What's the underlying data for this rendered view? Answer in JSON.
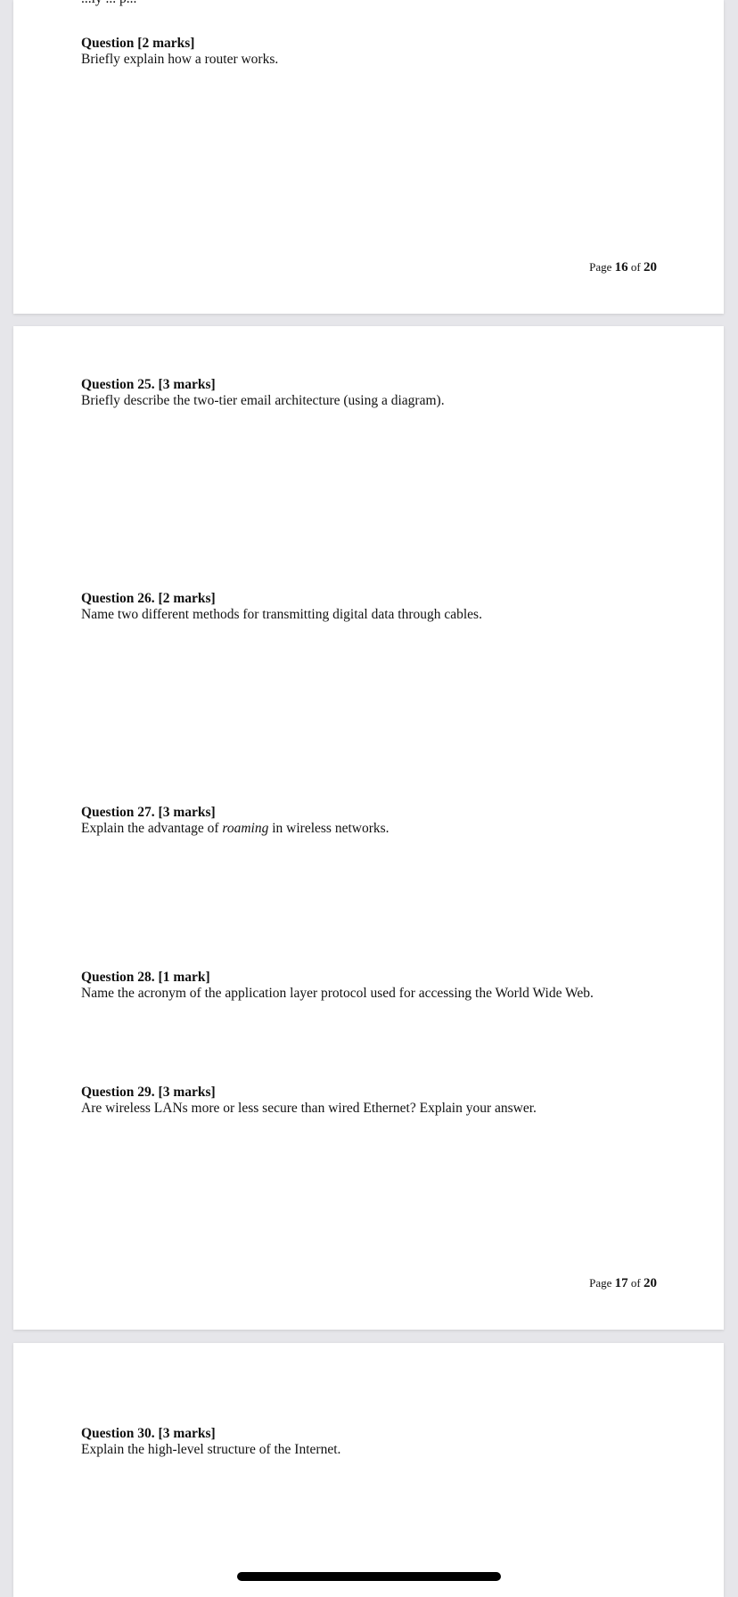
{
  "pages": [
    {
      "top_fragment": "...ly ... p...",
      "questions": [
        {
          "title": "Question  [2 marks]",
          "text": "Briefly explain how a router works."
        }
      ],
      "footer": {
        "prefix": "Page",
        "current": "16",
        "of": "of",
        "total": "20"
      }
    },
    {
      "questions": [
        {
          "title": "Question 25. [3 marks]",
          "text": "Briefly describe the two-tier email architecture (using a diagram)."
        },
        {
          "title": "Question 26. [2 marks]",
          "text": "Name two different methods for transmitting digital data through cables."
        },
        {
          "title": "Question 27. [3 marks]",
          "text_before": "Explain the advantage of",
          "text_em": "roaming",
          "text_after": "in wireless networks."
        },
        {
          "title": "Question 28. [1 mark]",
          "text": "Name the acronym of the application layer protocol used for accessing the World Wide Web."
        },
        {
          "title": "Question 29. [3 marks]",
          "text": "Are wireless LANs more or less secure than wired Ethernet? Explain your answer."
        }
      ],
      "footer": {
        "prefix": "Page",
        "current": "17",
        "of": "of",
        "total": "20"
      }
    },
    {
      "questions": [
        {
          "title": "Question 30. [3 marks]",
          "text": "Explain the high-level structure of the Internet."
        }
      ]
    }
  ]
}
